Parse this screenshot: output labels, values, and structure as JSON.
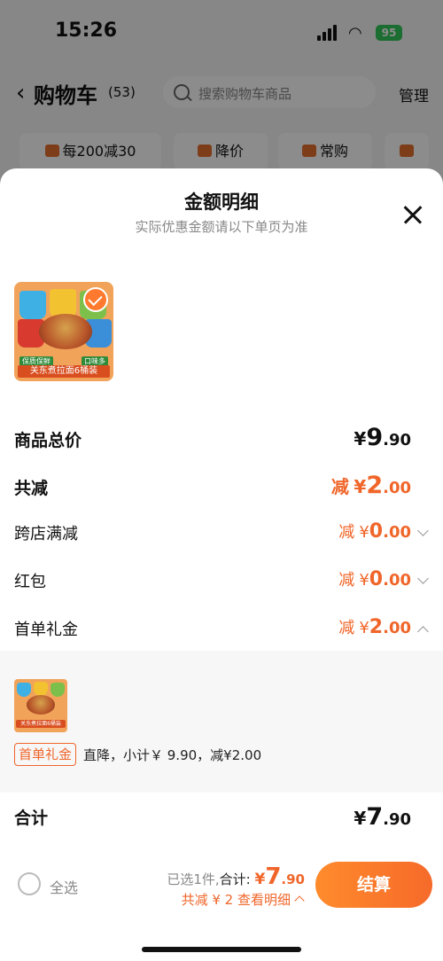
{
  "status_bar": {
    "time": "15:26",
    "battery": "95"
  },
  "nav": {
    "back_icon": "chevron-left-icon",
    "title": "购物车",
    "count": "(53)",
    "search_placeholder": "搜索购物车商品",
    "manage_label": "管理"
  },
  "chips": [
    {
      "label": "每200减30",
      "icon": "shop-icon"
    },
    {
      "label": "降价",
      "icon": "price-down-icon"
    },
    {
      "label": "常购",
      "icon": "cart-icon"
    },
    {
      "label": "",
      "icon": "folder-icon"
    }
  ],
  "sheet": {
    "title": "金额明细",
    "subtitle": "实际优惠金额请以下单页为准",
    "product": {
      "thumb_label": "关东煮拉面6桶装",
      "tag_top": "保质保鲜",
      "tag_side": "口味多",
      "selected": true
    }
  },
  "rows": {
    "goods_total": {
      "label": "商品总价",
      "yen": "¥",
      "int": "9",
      "dec": ".90"
    },
    "total_discount": {
      "label": "共减",
      "prefix": "减",
      "yen": "¥",
      "int": "2",
      "dec": ".00"
    },
    "cross_store": {
      "label": "跨店满减",
      "prefix": "减",
      "yen": "¥",
      "int": "0",
      "dec": ".00"
    },
    "red_packet": {
      "label": "红包",
      "prefix": "减",
      "yen": "¥",
      "int": "0",
      "dec": ".00"
    },
    "first_order": {
      "label": "首单礼金",
      "prefix": "减",
      "yen": "¥",
      "int": "2",
      "dec": ".00"
    }
  },
  "detail": {
    "mini_thumb_label": "关东煮拉面6桶装",
    "tag": "首单礼金",
    "description": "直降，小计￥ 9.90，减¥2.00"
  },
  "summary": {
    "label": "合计",
    "yen": "¥",
    "int": "7",
    "dec": ".90"
  },
  "footer": {
    "select_all": "全选",
    "selected_text": "已选1件,",
    "total_label": "合计:",
    "yen": "¥",
    "int": "7",
    "dec": ".90",
    "discount_text": "共减 ¥ 2  查看明细",
    "checkout_label": "结算"
  },
  "colors": {
    "accent": "#f0662a",
    "button": "#ff8b2c"
  }
}
